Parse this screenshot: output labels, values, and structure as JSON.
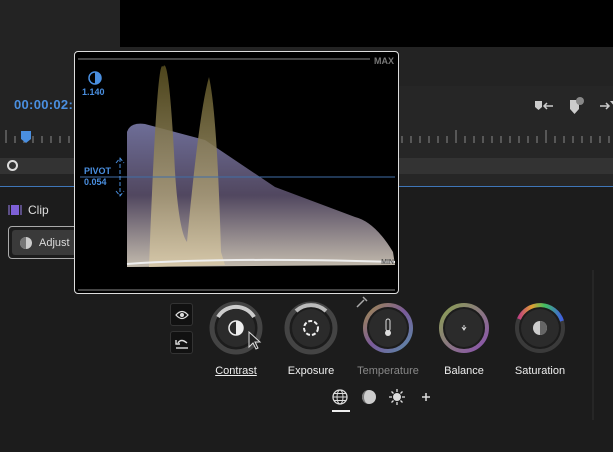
{
  "timeline": {
    "timecode": "00:00:02:"
  },
  "panel": {
    "clip_label": "Clip",
    "adjust_label": "Adjust"
  },
  "popup": {
    "max_label": "MAX",
    "min_label": "MIN",
    "contrast_value": "1.140",
    "pivot_label": "PIVOT",
    "pivot_value": "0.054"
  },
  "dials": [
    {
      "label": "Contrast",
      "icon": "contrast-icon",
      "active": true
    },
    {
      "label": "Exposure",
      "icon": "aperture-icon"
    },
    {
      "label": "Temperature",
      "icon": "thermometer-icon",
      "dimmed": true
    },
    {
      "label": "Balance",
      "icon": "balance-icon"
    },
    {
      "label": "Saturation",
      "icon": "saturation-icon"
    }
  ],
  "bottom_tabs": [
    "globe-icon",
    "shadows-icon",
    "highlights-icon",
    "add-icon"
  ],
  "colors": {
    "accent": "#4a8fe0",
    "background": "#1c1c1c"
  }
}
